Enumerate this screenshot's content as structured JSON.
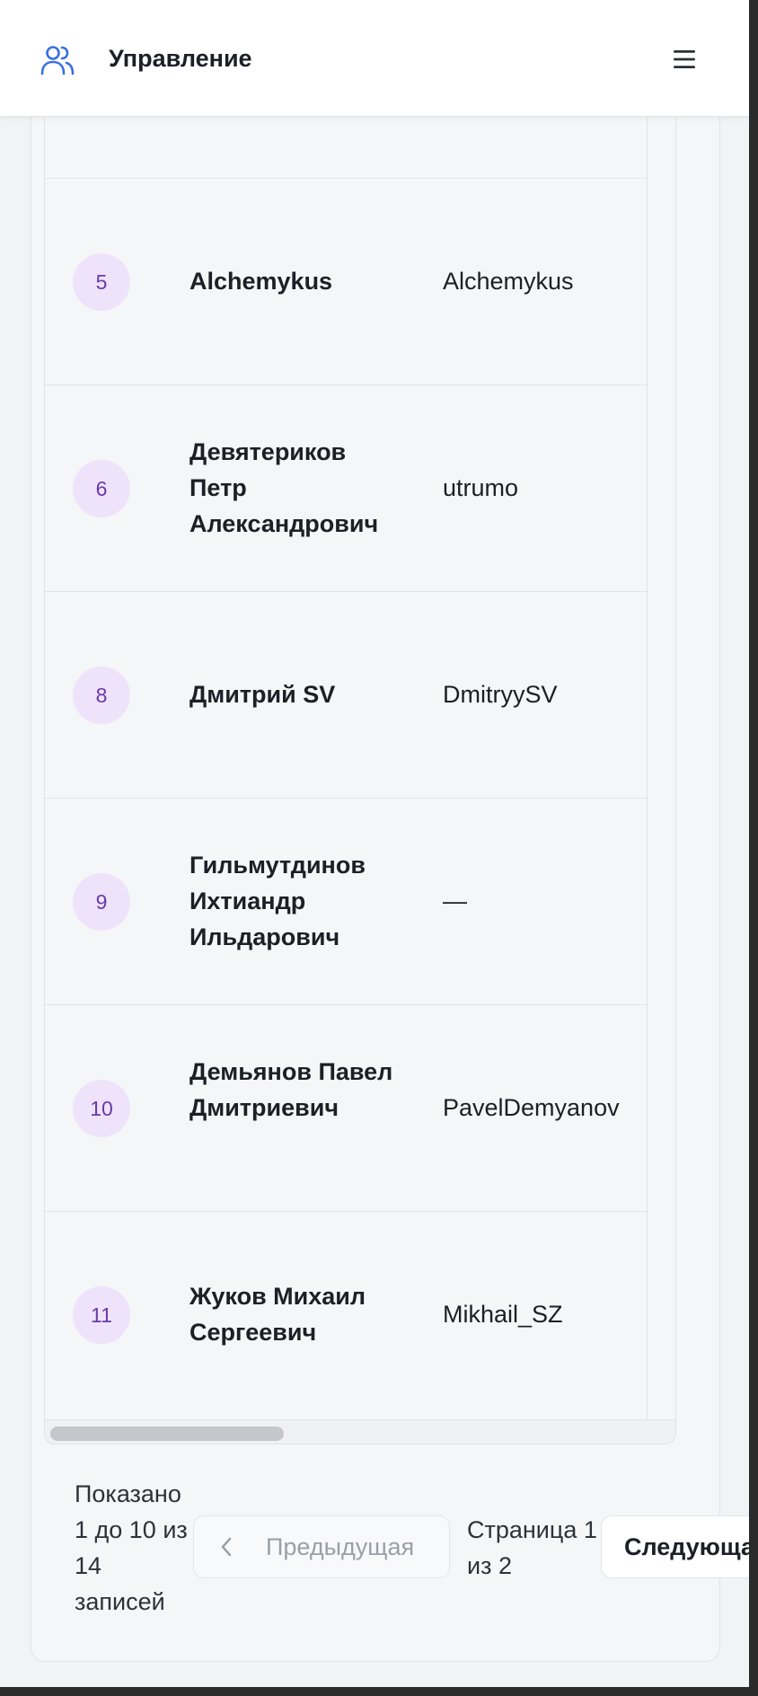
{
  "header": {
    "title": "Управление",
    "logo_icon": "users-icon",
    "menu_icon": "hamburger-menu-icon"
  },
  "table": {
    "rows": [
      {
        "num": "5",
        "name": "Alchemykus",
        "login": "Alchemykus"
      },
      {
        "num": "6",
        "name": "Девятериков Петр Александрович",
        "login": "utrumo"
      },
      {
        "num": "8",
        "name": "Дмитрий SV",
        "login": "DmitryySV"
      },
      {
        "num": "9",
        "name": "Гильмутдинов Ихтиандр Ильдарович",
        "login": "—"
      },
      {
        "num": "10",
        "name": "Демьянов Павел Дмитриевич",
        "login": "PavelDemyanov"
      },
      {
        "num": "11",
        "name": "Жуков Михаил Сергеевич",
        "login": "Mikhail_SZ"
      }
    ]
  },
  "pagination": {
    "info": "Показано 1 до 10 из 14 записей",
    "prev_label": "Предыдущая",
    "page_info": "Страница 1 из 2",
    "next_label": "Следующая"
  },
  "colors": {
    "badge_bg": "#efe3fb",
    "badge_text": "#6a3aa8",
    "accent_icon": "#3b6fe0"
  }
}
